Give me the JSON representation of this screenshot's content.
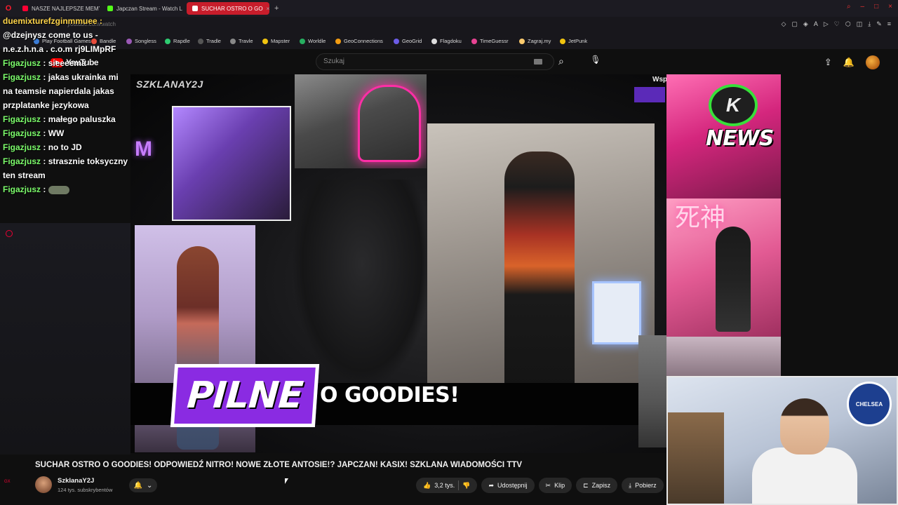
{
  "browser": {
    "tabs": [
      {
        "label": "NASZE NAJLEPSZE MEMY",
        "favicon_color": "#ff0033",
        "active": false
      },
      {
        "label": "Japczan Stream - Watch L",
        "favicon_color": "#53fc18",
        "active": false
      },
      {
        "label": "SUCHAR OSTRO O GO",
        "favicon_color": "#ffffff",
        "active": true
      }
    ],
    "new_tab": "+",
    "url": "youtube.com/watch"
  },
  "bookmarks": [
    {
      "label": "Play Football Games",
      "color": "#3a7bd5"
    },
    {
      "label": "Bandle",
      "color": "#e74c3c"
    },
    {
      "label": "Songless",
      "color": "#9b59b6"
    },
    {
      "label": "Rapdle",
      "color": "#2ecc71"
    },
    {
      "label": "Tradle",
      "color": "#555555"
    },
    {
      "label": "Travle",
      "color": "#888888"
    },
    {
      "label": "Mapster",
      "color": "#f1c40f"
    },
    {
      "label": "Worldle",
      "color": "#27ae60"
    },
    {
      "label": "GeoConnections",
      "color": "#f39c12"
    },
    {
      "label": "GeoGrid",
      "color": "#6c5ce7"
    },
    {
      "label": "Flagdoku",
      "color": "#dddddd"
    },
    {
      "label": "TimeGuessr",
      "color": "#e84393"
    },
    {
      "label": "Zagraj.my",
      "color": "#fdcb6e"
    },
    {
      "label": "JetPunk",
      "color": "#f1c40f"
    }
  ],
  "youtube": {
    "logo_text": "YouTube",
    "search_placeholder": "Szukaj",
    "video_title": "SUCHAR OSTRO O GOODIES! ODPOWIEDŹ NITRO! NOWE ZŁOTE ANTOSIE!? JAPCZAN! KASIX! SZKLANA WIADOMOŚCI TTV",
    "channel_name": "SzklanaY2J",
    "subscribers": "124 tys. subskrybentów",
    "likes": "3,2 tys.",
    "share": "Udostępnij",
    "clip": "Klip",
    "save": "Zapisz",
    "download": "Pobierz"
  },
  "video": {
    "watermark": "SZKLANAY2J",
    "banner_label": "PILNE",
    "banner_text": "O GOODIES!",
    "corner_text": "Wsp",
    "news_logo": "K",
    "news_text": "NEWS",
    "kanji": "死神",
    "club_badge": "CHELSEA"
  },
  "chat": [
    {
      "user": "duemixturefzginmmuee",
      "user_color": "yellow",
      "message": "@dzejnysz come to us - n.e.z.h.n.a . c.o.m rj9LIMpRF"
    },
    {
      "user": "Figazjusz",
      "user_color": "green",
      "message": "sieeeema"
    },
    {
      "user": "Figazjusz",
      "user_color": "green",
      "message": "jakas ukrainka mi na teamsie napierdala jakas przplatanke jezykowa"
    },
    {
      "user": "Figazjusz",
      "user_color": "green",
      "message": "małego paluszka"
    },
    {
      "user": "Figazjusz",
      "user_color": "green",
      "message": "WW"
    },
    {
      "user": "Figazjusz",
      "user_color": "green",
      "message": "no to JD"
    },
    {
      "user": "Figazjusz",
      "user_color": "green",
      "message": "strasznie toksyczny ten stream"
    },
    {
      "user": "Figazjusz",
      "user_color": "green",
      "message": "",
      "emote": "pepe-emote"
    }
  ],
  "sidebar_badge": "GX",
  "colors": {
    "accent_red": "#ff0000",
    "active_tab": "#c81d2b",
    "pilne_purple": "#8a2be2",
    "chat_yellow": "#ffd54a",
    "chat_green": "#7cfc6b"
  }
}
